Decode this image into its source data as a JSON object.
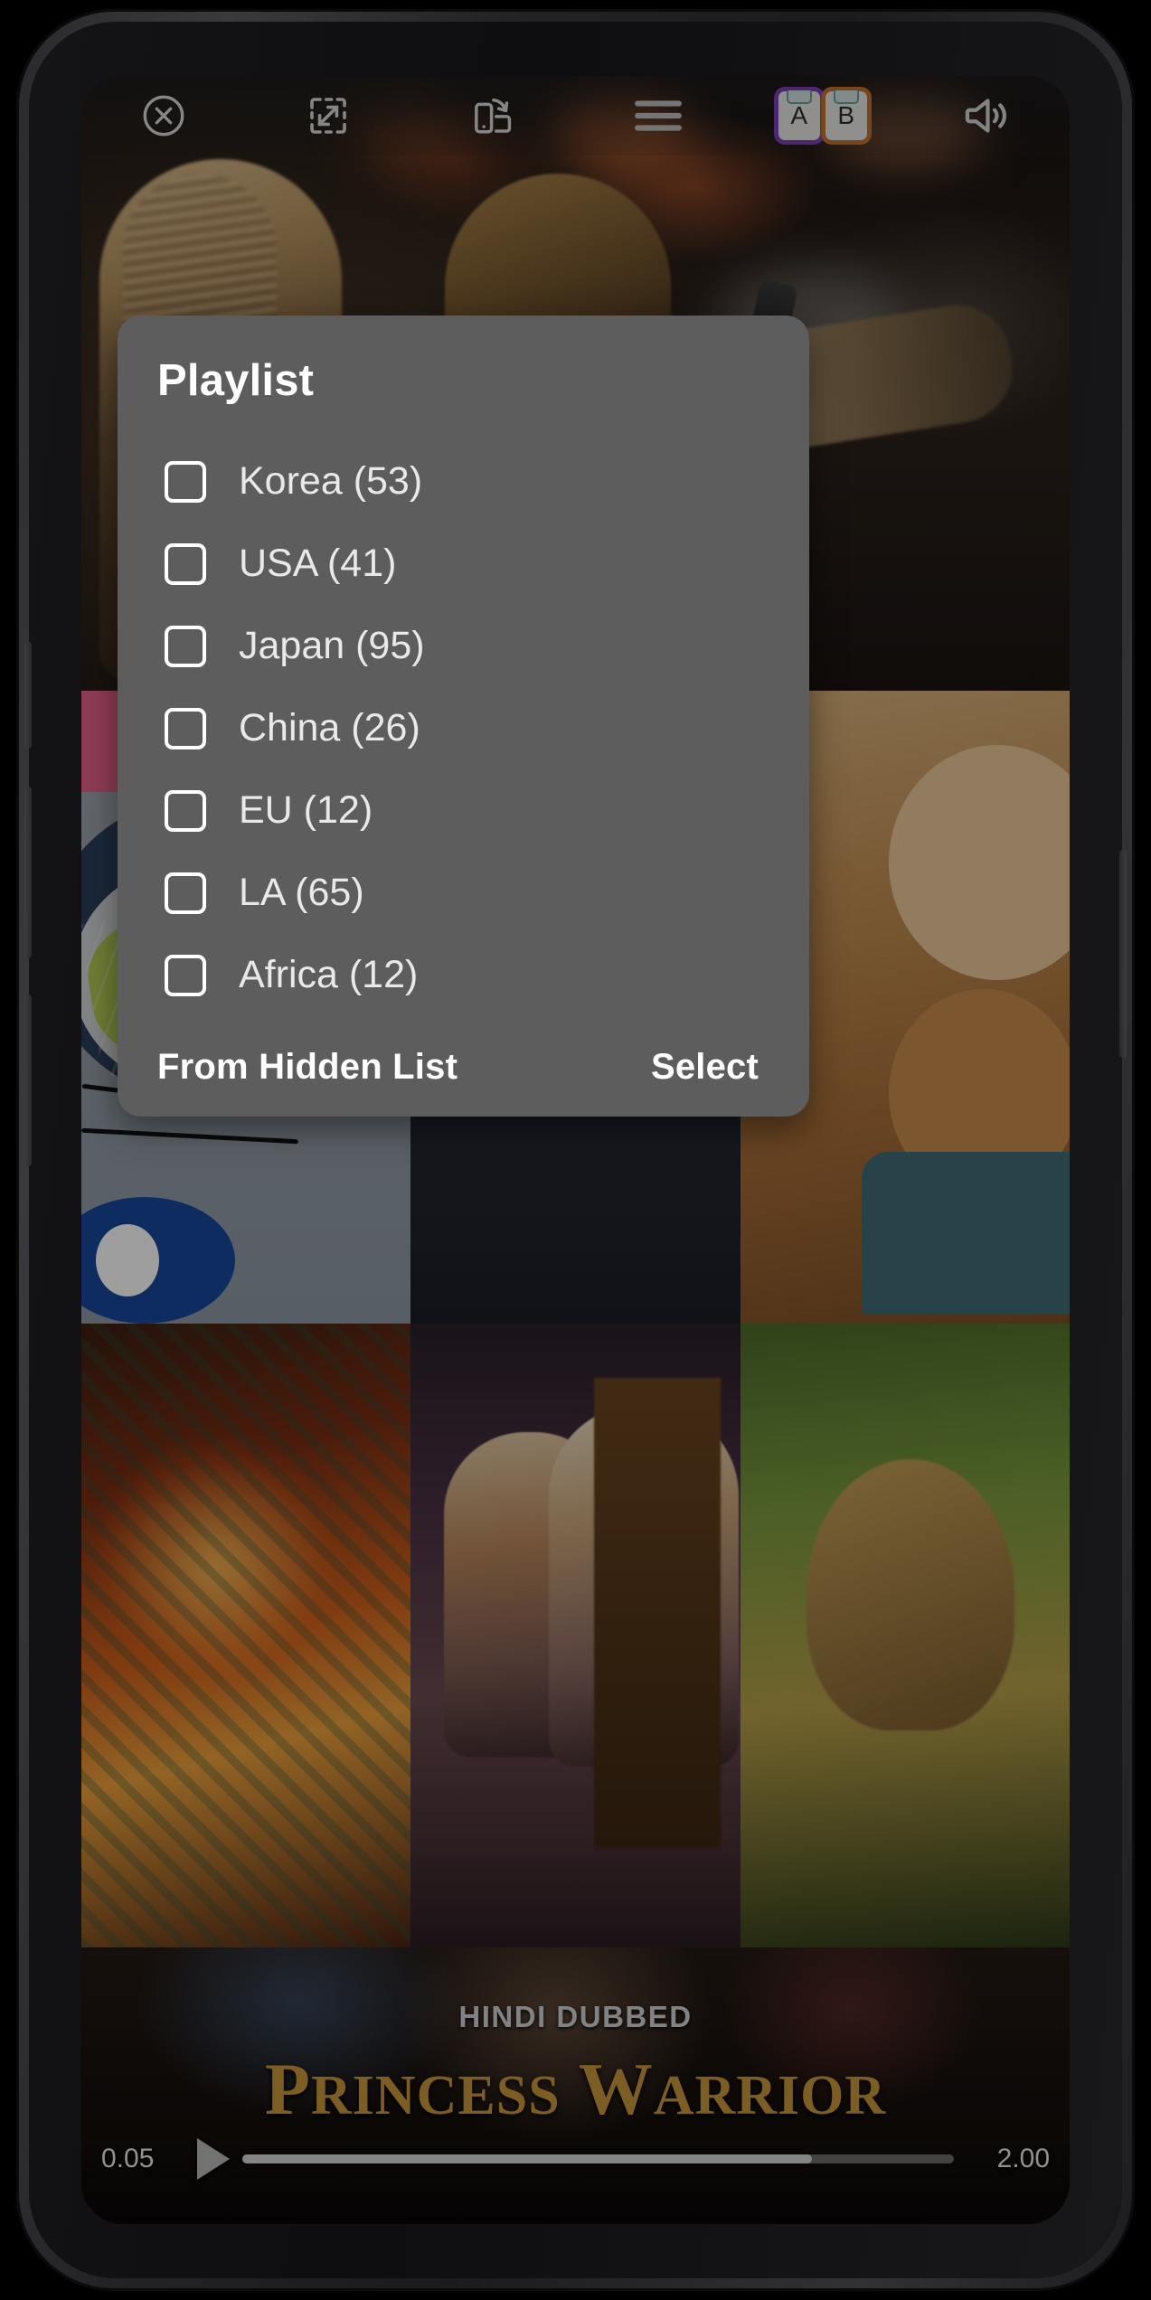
{
  "toolbar": {
    "items": [
      {
        "name": "close-icon",
        "label": "Close"
      },
      {
        "name": "fullscreen-expand-icon",
        "label": "Expand"
      },
      {
        "name": "rotate-screen-icon",
        "label": "Rotate Screen"
      },
      {
        "name": "menu-icon",
        "label": "Menu"
      },
      {
        "name": "ab-repeat-icon",
        "label": "A B"
      },
      {
        "name": "volume-icon",
        "label": "Volume"
      }
    ],
    "ab": {
      "a": "A",
      "b": "B",
      "a_color": "#7b3fb5",
      "b_color": "#c0712e"
    }
  },
  "dialog": {
    "title": "Playlist",
    "options": [
      {
        "label": "Korea (53)",
        "checked": false
      },
      {
        "label": "USA (41)",
        "checked": false
      },
      {
        "label": "Japan (95)",
        "checked": false
      },
      {
        "label": "China (26)",
        "checked": false
      },
      {
        "label": "EU (12)",
        "checked": false
      },
      {
        "label": "LA (65)",
        "checked": false
      },
      {
        "label": "Africa (12)",
        "checked": false
      }
    ],
    "actions": {
      "secondary": "From Hidden List",
      "primary": "Select"
    },
    "background_color": "#5d5d5d"
  },
  "player": {
    "current_time": "0.05",
    "total_time": "2.00",
    "progress_percent": 80,
    "play_state": "paused",
    "banner": "HINDI DUBBED",
    "movie_title_1": "P",
    "movie_title_2": "RINCESS",
    "movie_title_3": "W",
    "movie_title_4": "ARRIOR"
  }
}
